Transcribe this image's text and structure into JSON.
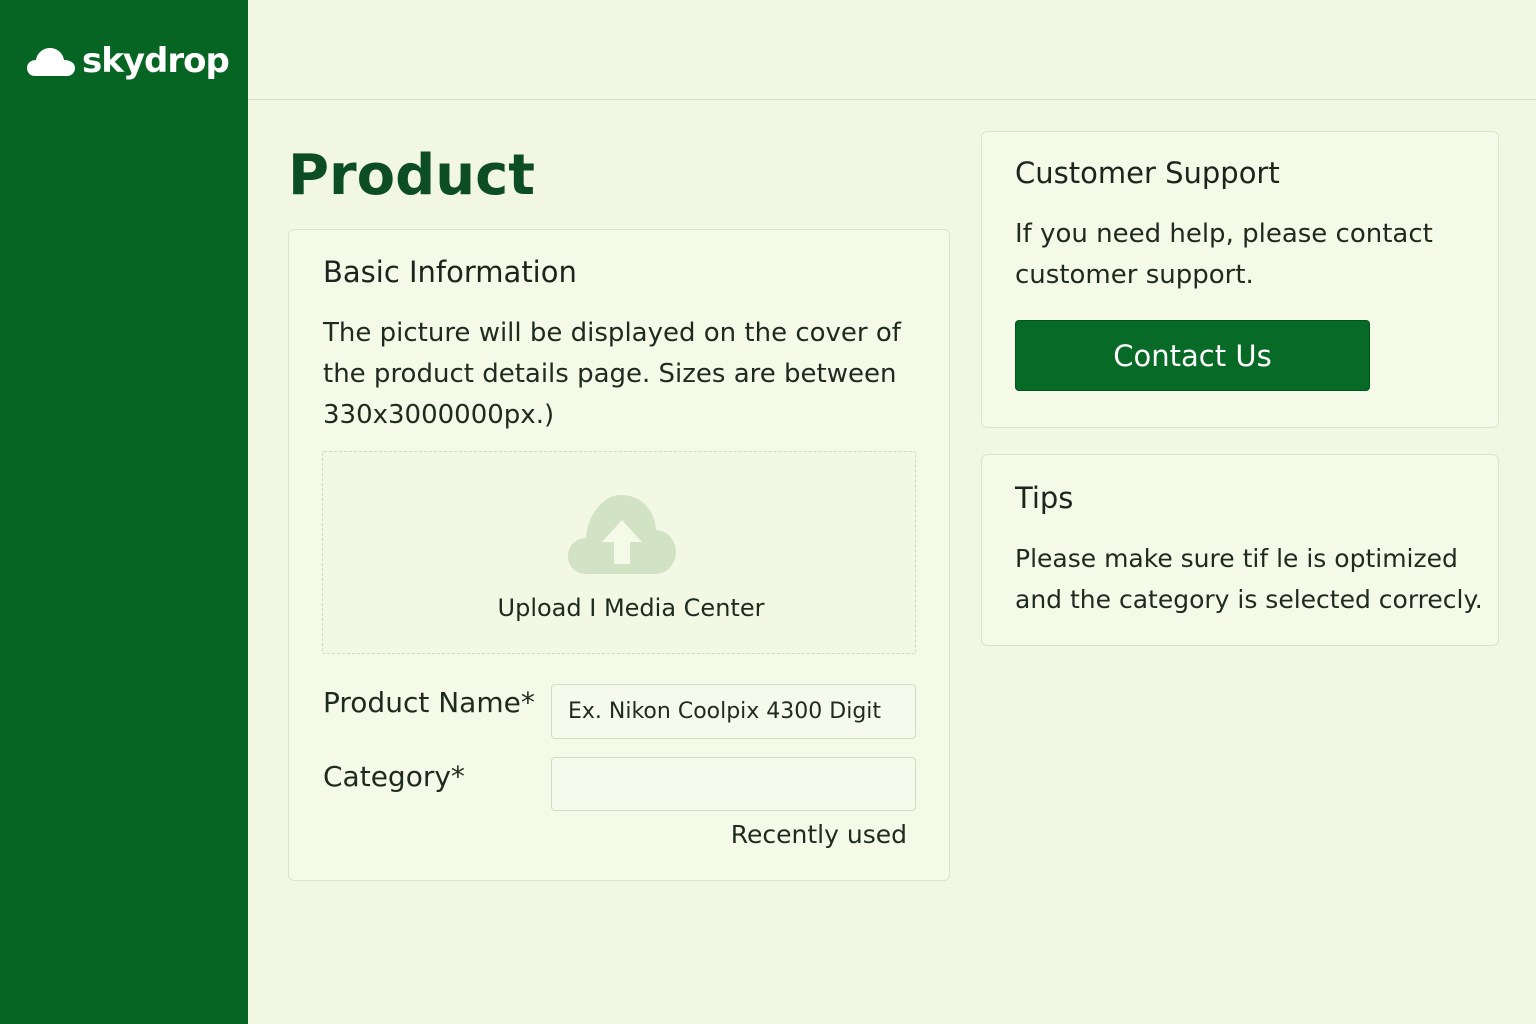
{
  "brand": {
    "name": "skydrop"
  },
  "page": {
    "title": "Product"
  },
  "basic_info": {
    "heading": "Basic Information",
    "description": "The picture will be displayed on the cover of the product details page. Sizes are between 330x3000000px.)",
    "upload": {
      "label": "Upload I Media Center",
      "icon": "cloud-upload-icon"
    },
    "product_name": {
      "label": "Product Name*",
      "placeholder": "Ex. Nikon Coolpix 4300 Digit",
      "value": ""
    },
    "category": {
      "label": "Category*",
      "value": ""
    },
    "recently_used": "Recently used"
  },
  "support": {
    "heading": "Customer Support",
    "text": "If you need help, please contact customer support.",
    "button_label": "Contact Us"
  },
  "tips": {
    "heading": "Tips",
    "text": "Please make sure tif le is optimized and the category is selected correcly."
  },
  "colors": {
    "sidebar": "#076524",
    "background": "#f1f7e3",
    "title": "#0d4d24",
    "button": "#086a27",
    "upload_icon": "#d2e2c4"
  }
}
